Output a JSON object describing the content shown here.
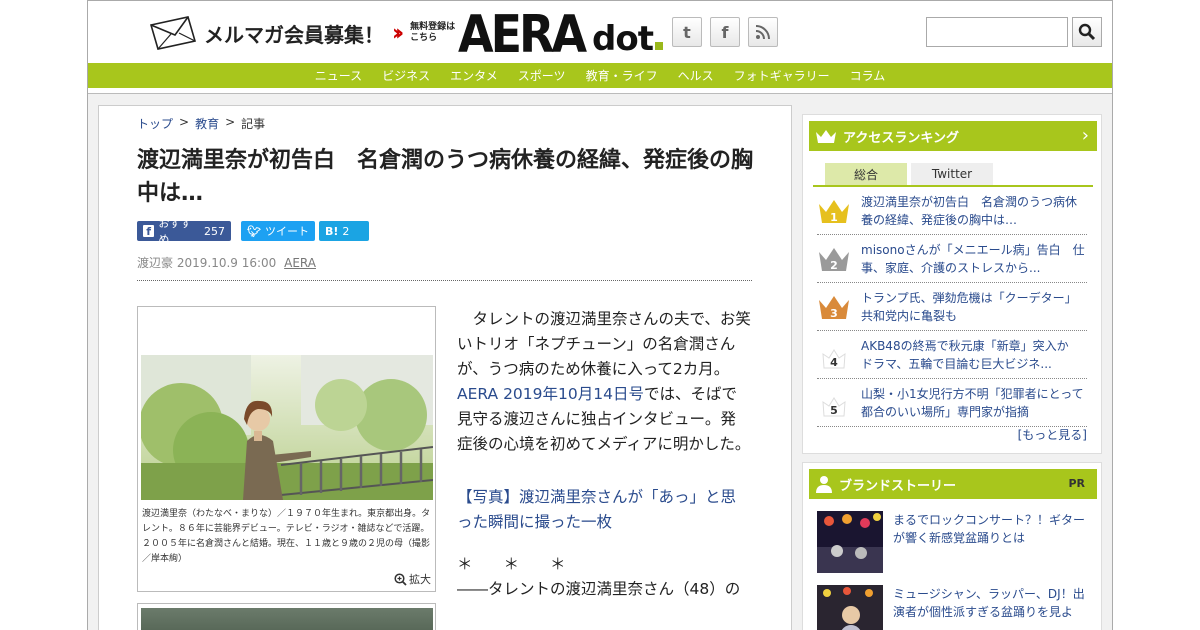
{
  "header": {
    "mail_text": "メルマガ会員募集！",
    "free_reg_1": "無料登録は",
    "free_reg_2": "こちら",
    "logo_aera": "AERA",
    "logo_dot": "dot"
  },
  "nav": {
    "items": [
      "ニュース",
      "ビジネス",
      "エンタメ",
      "スポーツ",
      "教育・ライフ",
      "ヘルス",
      "フォトギャラリー",
      "コラム"
    ]
  },
  "breadcrumb": {
    "home": "トップ",
    "category": "教育",
    "current": "記事"
  },
  "article": {
    "title": "渡辺満里奈が初告白　名倉潤のうつ病休養の経緯、発症後の胸中は…",
    "share": {
      "fb_label": "おすすめ",
      "fb_count": "257",
      "tw_label": "ツイート",
      "hb_label": "B!",
      "hb_count": "2"
    },
    "author": "渡辺豪",
    "date": "2019.10.9 16:00",
    "org": "AERA",
    "photo_caption": "渡辺満里奈（わたなべ・まりな）／１９７０年生まれ。東京都出身。タレント。８６年に芸能界デビュー。テレビ・ラジオ・雑誌などで活躍。２００５年に名倉潤さんと結婚。現在、１１歳と９歳の２児の母（撮影／岸本絢）",
    "zoom_label": "拡大",
    "para1_a": "タレントの渡辺満里奈さんの夫で、お笑いトリオ「ネプチューン」の名倉潤さんが、うつ病のため休養に入って2カ月。",
    "para1_link": "AERA 2019年10月14日号",
    "para1_b": "では、そばで見守る渡辺さんに独占インタビュー。発症後の心境を初めてメディアに明かした。",
    "photo_link": "【写真】渡辺満里奈さんが「あっ」と思った瞬間に撮った一枚",
    "stars": "＊　　＊　　＊",
    "lead": "――タレントの渡辺満里奈さん（48）の"
  },
  "sidebar": {
    "ranking_title": "アクセスランキング",
    "tabs": [
      "総合",
      "Twitter"
    ],
    "ranking": [
      {
        "rank": "1",
        "text": "渡辺満里奈が初告白　名倉潤のうつ病休養の経緯、発症後の胸中は…"
      },
      {
        "rank": "2",
        "text": "misonoさんが「メニエール病」告白　仕事、家庭、介護のストレスから..."
      },
      {
        "rank": "3",
        "text": "トランプ氏、弾劾危機は「クーデター」　共和党内に亀裂も"
      },
      {
        "rank": "4",
        "text": "AKB48の終焉で秋元康「新章」突入か　ドラマ、五輪で目論む巨大ビジネ..."
      },
      {
        "rank": "5",
        "text": "山梨・小1女児行方不明「犯罪者にとって都合のいい場所」専門家が指摘"
      }
    ],
    "more": "[もっと見る]",
    "brand_title": "ブランドストーリー",
    "brand_pr": "PR",
    "brand_items": [
      {
        "text": "まるでロックコンサート？！ギターが響く新感覚盆踊りとは"
      },
      {
        "text": "ミュージシャン、ラッパー、DJ！出演者が個性派すぎる盆踊りを見よ"
      }
    ]
  },
  "colors": {
    "accent_green": "#a8c61c",
    "link_blue": "#2a4b8d",
    "gold": "#e6c01e",
    "silver": "#9a9a9a",
    "bronze": "#d98a3a"
  }
}
